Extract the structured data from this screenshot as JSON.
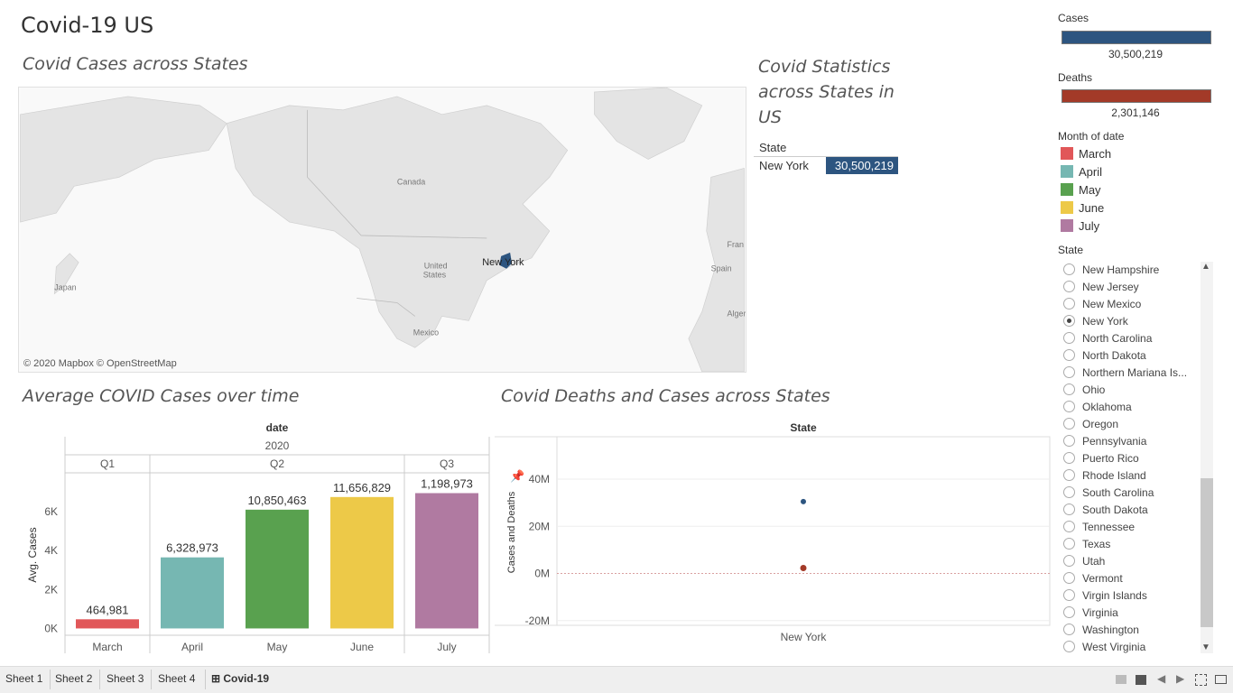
{
  "dashboard": {
    "title": "Covid-19 US"
  },
  "map_panel": {
    "title": "Covid Cases across States",
    "labels": {
      "canada": "Canada",
      "us": "United States",
      "mexico": "Mexico",
      "japan": "Japan",
      "spain": "Spain",
      "france": "Fran",
      "algeria": "Alger",
      "new_york": "New York"
    },
    "attribution": "© 2020 Mapbox © OpenStreetMap",
    "highlight_color": "#2d5580"
  },
  "stats_panel": {
    "title_lines": [
      "Covid Statistics",
      "across States in",
      "US"
    ],
    "header": "State",
    "row_state": "New York",
    "row_value": "30,500,219"
  },
  "legends": {
    "cases": {
      "title": "Cases",
      "value": "30,500,219",
      "color": "#2d5580"
    },
    "deaths": {
      "title": "Deaths",
      "value": "2,301,146",
      "color": "#a33a28"
    },
    "month": {
      "title": "Month of date",
      "items": [
        {
          "label": "March",
          "color": "#e15759"
        },
        {
          "label": "April",
          "color": "#76b7b2"
        },
        {
          "label": "May",
          "color": "#59a14f"
        },
        {
          "label": "June",
          "color": "#edc948"
        },
        {
          "label": "July",
          "color": "#b07aa1"
        }
      ]
    },
    "state_filter": {
      "title": "State",
      "selected": "New York",
      "items": [
        "New Hampshire",
        "New Jersey",
        "New Mexico",
        "New York",
        "North Carolina",
        "North Dakota",
        "Northern Mariana Is...",
        "Ohio",
        "Oklahoma",
        "Oregon",
        "Pennsylvania",
        "Puerto Rico",
        "Rhode Island",
        "South Carolina",
        "South Dakota",
        "Tennessee",
        "Texas",
        "Utah",
        "Vermont",
        "Virgin Islands",
        "Virginia",
        "Washington",
        "West Virginia"
      ]
    }
  },
  "bar_panel": {
    "title": "Average COVID Cases over time",
    "header_field": "date",
    "header_year": "2020",
    "quarters": [
      "Q1",
      "Q2",
      "Q3"
    ],
    "ylabel": "Avg. Cases",
    "ytick_labels": [
      "0K",
      "2K",
      "4K",
      "6K"
    ]
  },
  "scatter_panel": {
    "title": "Covid  Deaths and Cases across States",
    "header": "State",
    "ylabel": "Cases and Deaths",
    "ytick_labels": [
      "-20M",
      "0M",
      "20M",
      "40M"
    ],
    "xcategory": "New York"
  },
  "tabs": [
    "Sheet 1",
    "Sheet 2",
    "Sheet 3",
    "Sheet 4",
    "Covid-19"
  ],
  "active_tab": "Covid-19",
  "chart_data": [
    {
      "type": "bar",
      "title": "Average COVID Cases over time",
      "categories": [
        "March",
        "April",
        "May",
        "June",
        "July"
      ],
      "quarters": [
        "Q1",
        "Q2",
        "Q2",
        "Q2",
        "Q3"
      ],
      "values": [
        470,
        3650,
        6100,
        6750,
        6950
      ],
      "data_labels": [
        "464,981",
        "6,328,973",
        "10,850,463",
        "11,656,829",
        "1,198,973"
      ],
      "ylabel": "Avg. Cases",
      "ylim": [
        -350,
        7900
      ]
    },
    {
      "type": "scatter",
      "title": "Covid  Deaths and Cases across States",
      "categories": [
        "New York"
      ],
      "series": [
        {
          "name": "Cases",
          "values": [
            30500219
          ],
          "color": "#2d5580"
        },
        {
          "name": "Deaths",
          "values": [
            2301146
          ],
          "color": "#a33a28"
        }
      ],
      "ylabel": "Cases and Deaths",
      "ylim": [
        -22000000,
        58000000
      ]
    }
  ]
}
